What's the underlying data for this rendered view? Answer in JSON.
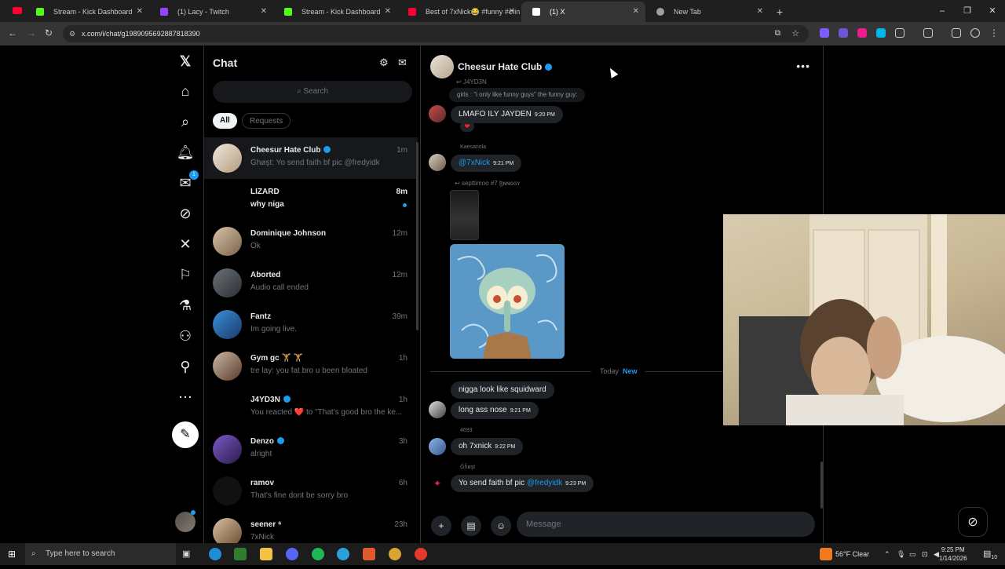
{
  "browser": {
    "tabs": [
      {
        "title": "Stream - Kick Dashboard",
        "fav_color": "#53fc18"
      },
      {
        "title": "(1) Lacy - Twitch",
        "fav_color": "#9146ff"
      },
      {
        "title": "Stream - Kick Dashboard",
        "fav_color": "#53fc18"
      },
      {
        "title": "Best of 7xNick😂 #funny #crin",
        "fav_color": "#ff0033"
      },
      {
        "title": "(1) X",
        "fav_color": "#ffffff"
      },
      {
        "title": "New Tab",
        "fav_color": "#9aa0a6"
      }
    ],
    "new_tab": "+",
    "url": "x.com/i/chat/g1989095692887818390"
  },
  "sidebar": {
    "mail_badge": "1"
  },
  "chat_list": {
    "title": "Chat",
    "search_placeholder": "Search",
    "filters": [
      "All",
      "Requests"
    ],
    "conversations": [
      {
        "name": "Cheesur Hate Club",
        "preview": "Ĝĥøşt: Yo send faith bf pic @fredyidk",
        "time": "1m",
        "verified": true,
        "unread": false,
        "active": true
      },
      {
        "name": "LIZARD",
        "preview": "why niga",
        "time": "8m",
        "verified": false,
        "unread": true,
        "active": false
      },
      {
        "name": "Dominique Johnson",
        "preview": "Ok",
        "time": "12m",
        "verified": false,
        "unread": false,
        "active": false
      },
      {
        "name": "Aborted",
        "preview": "Audio call ended",
        "time": "12m",
        "verified": false,
        "unread": false,
        "active": false
      },
      {
        "name": "Fantz",
        "preview": "Im going live.",
        "time": "39m",
        "verified": false,
        "unread": false,
        "active": false
      },
      {
        "name": "Gym gc 🏋 🏋",
        "preview": "tre lay: you fat bro u been bloated",
        "time": "1h",
        "verified": false,
        "unread": false,
        "active": false
      },
      {
        "name": "J4YD3N",
        "preview": "You reacted ❤️ to \"That's good bro  the ke...",
        "time": "1h",
        "verified": true,
        "unread": false,
        "active": false
      },
      {
        "name": "Denzo",
        "preview": "alright",
        "time": "3h",
        "verified": true,
        "unread": false,
        "active": false
      },
      {
        "name": "ramov",
        "preview": "That's fine dont be sorry bro",
        "time": "6h",
        "verified": false,
        "unread": false,
        "active": false
      },
      {
        "name": "seener ⁶",
        "preview": "7xNick",
        "time": "23h",
        "verified": false,
        "unread": false,
        "active": false
      }
    ]
  },
  "conversation": {
    "title": "Cheesur Hate Club",
    "reply1_author": "J4YD3N",
    "reply1_quote": "girls : \"i only like funny guys\"      the funny guy:",
    "msg1_text": "LMAFO ILY JAYDEN",
    "msg1_time": "9:20 PM",
    "msg1_reaction": "❤",
    "msg2_sender": "Kaesariola",
    "msg2_text": "@7xNick",
    "msg2_time": "9:21 PM",
    "reply2_label": "septtimoo #7 ɮɴɴɢɢʏ",
    "today_label": "Today",
    "new_label": "New",
    "msg3_text": "nigga look like squidward",
    "msg4_text": "long ass nose",
    "msg4_time": "9:21 PM",
    "msg5_sender": "4693",
    "msg5_text": "oh 7xnick",
    "msg5_time": "9:22 PM",
    "msg6_sender": "Ĝĥøşt",
    "msg6_text": "Yo send faith bf pic",
    "msg6_mention": "@fredyidk",
    "msg6_time": "9:23 PM",
    "composer_placeholder": "Message"
  },
  "taskbar": {
    "search_placeholder": "Type here to search",
    "weather": "56°F  Clear",
    "time": "9:25 PM",
    "date": "1/14/2026",
    "notif_count": "10"
  },
  "colors": {
    "accent": "#1d9bf0",
    "background": "#000000",
    "bubble": "#202327"
  }
}
